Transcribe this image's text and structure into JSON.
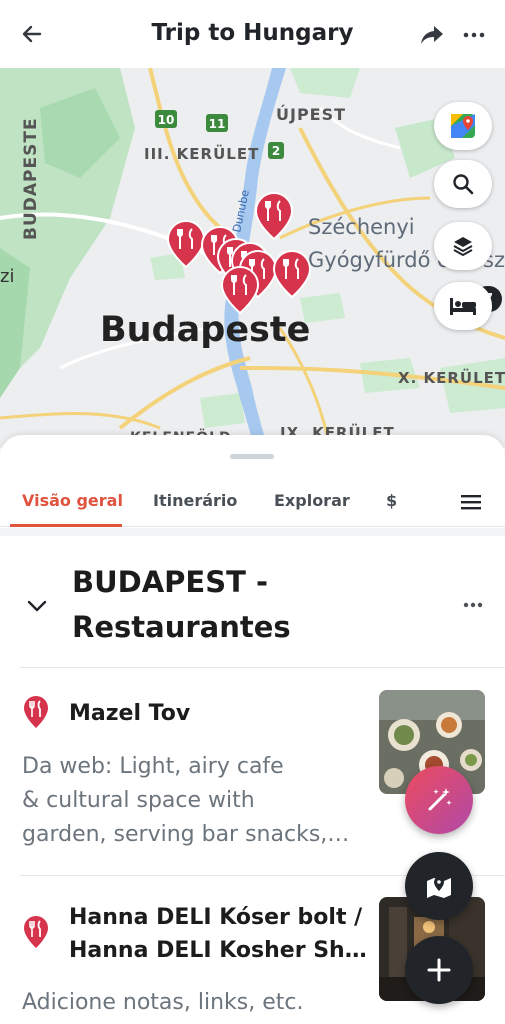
{
  "header": {
    "title": "Trip to Hungary",
    "back_icon": "arrow-left-icon",
    "share_icon": "share-arrow-icon",
    "more_icon": "more-horizontal-icon"
  },
  "map": {
    "labels": {
      "ujpest": "ÚJPEST",
      "iii_kerulet": "III. KERÜLET",
      "budapeste_vertical": "BUDAPESTE",
      "szechenyi_1": "Széchenyi",
      "szechenyi_2": "Gyógyfürdő és Uszoda",
      "budapeste_city": "Budapeste",
      "x_kerulet": "X. KERÜLET",
      "ix_kerulet": "IX. KERÜLET",
      "kelenfold": "KELENFÖLD",
      "duna": "Dunube",
      "zi": "zi",
      "route_10": "10",
      "route_11": "11",
      "route_2": "2"
    },
    "layers_count": "7",
    "controls": [
      "google-maps-icon",
      "search-icon",
      "layers-icon",
      "bed-icon"
    ]
  },
  "tabs": [
    {
      "label": "Visão geral",
      "active": true
    },
    {
      "label": "Itinerário",
      "active": false
    },
    {
      "label": "Explorar",
      "active": false
    },
    {
      "label": "$",
      "active": false
    }
  ],
  "section": {
    "title_line1": "BUDAPEST -",
    "title_line2": "Restaurantes"
  },
  "places": [
    {
      "name": "Mazel Tov",
      "desc_line1": "Da web: Light, airy cafe",
      "desc_line2": "& cultural space with",
      "desc_line3": "garden, serving bar snacks,…"
    },
    {
      "name_line1": "Hanna DELI Kóser bolt /",
      "name_line2": "Hanna DELI Kosher Sh…",
      "notes_placeholder": "Adicione notas, links, etc."
    }
  ],
  "colors": {
    "accent": "#e0533f",
    "pin": "#d6334d",
    "dark_fab": "#212529",
    "magic_start": "#ec4b5e",
    "magic_end": "#b04aa8"
  }
}
